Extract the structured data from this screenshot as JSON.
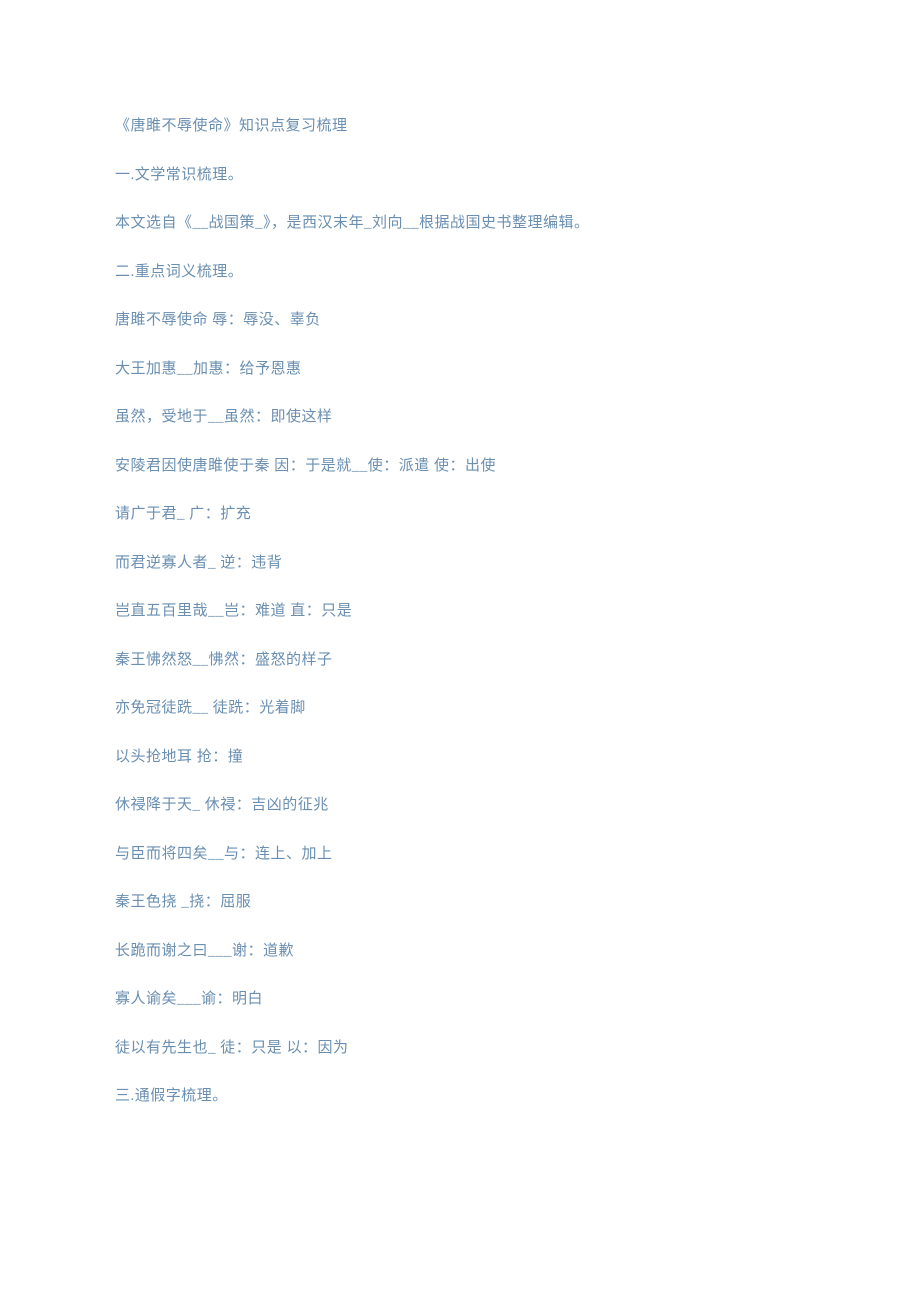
{
  "title": "《唐雎不辱使命》知识点复习梳理",
  "sections": [
    {
      "text": "一.文学常识梳理。"
    },
    {
      "text": "本文选自《__战国策_》，是西汉末年_刘向__根据战国史书整理编辑。"
    },
    {
      "text": "二.重点词义梳理。"
    },
    {
      "text": "唐雎不辱使命    辱：辱没、辜负"
    },
    {
      "text": "大王加惠__加惠：给予恩惠"
    },
    {
      "text": "虽然，受地于__虽然：即使这样"
    },
    {
      "text": "安陵君因使唐雎使于秦    因：于是就__使：派遣    使：出使"
    },
    {
      "text": "请广于君_    广：扩充"
    },
    {
      "text": "而君逆寡人者_    逆：违背"
    },
    {
      "text": "岂直五百里哉__岂：难道      直：只是"
    },
    {
      "text": "秦王怫然怒__怫然：盛怒的样子"
    },
    {
      "text": "亦免冠徒跣__    徒跣：光着脚"
    },
    {
      "text": "以头抢地耳        抢：撞"
    },
    {
      "text": "休祲降于天_    休祲：吉凶的征兆"
    },
    {
      "text": "与臣而将四矣__与：连上、加上"
    },
    {
      "text": "秦王色挠    _挠：屈服"
    },
    {
      "text": "长跪而谢之曰___谢：道歉"
    },
    {
      "text": "寡人谕矣___谕：明白"
    },
    {
      "text": "徒以有先生也_    徒：只是      以：因为"
    },
    {
      "text": "三.通假字梳理。"
    }
  ]
}
